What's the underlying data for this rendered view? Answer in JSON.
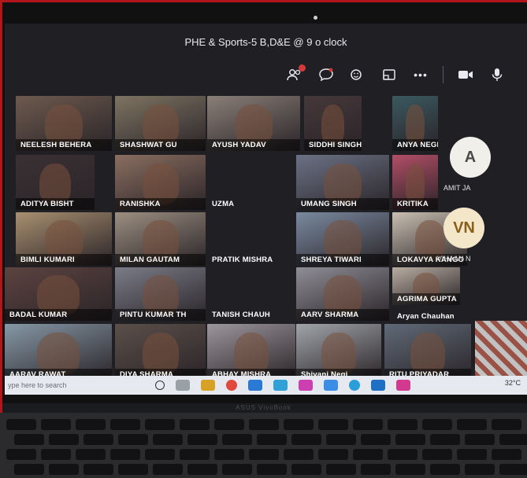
{
  "meeting": {
    "title": "PHE & Sports-5 B,D&E @ 9 o clock"
  },
  "toolbar": {
    "items": [
      {
        "icon": "participants-icon",
        "badge": "2"
      },
      {
        "icon": "chat-icon"
      },
      {
        "icon": "reactions-icon"
      },
      {
        "icon": "share-screen-icon"
      },
      {
        "icon": "more-icon",
        "glyph": "•••"
      },
      {
        "icon": "camera-icon"
      },
      {
        "icon": "microphone-icon"
      }
    ]
  },
  "participants": [
    {
      "name": "NEELESH BEHERA"
    },
    {
      "name": "SHASHWAT GU"
    },
    {
      "name": "AYUSH YADAV"
    },
    {
      "name": "SIDDHI SINGH"
    },
    {
      "name": "ANYA NEGI"
    },
    {
      "name": "ADITYA BISHT"
    },
    {
      "name": "RANISHKA"
    },
    {
      "name": "UZMA"
    },
    {
      "name": "UMANG SINGH"
    },
    {
      "name": "KRITIKA"
    },
    {
      "name": "BIMLI KUMARI"
    },
    {
      "name": "MILAN GAUTAM"
    },
    {
      "name": "PRATIK MISHRA"
    },
    {
      "name": "SHREYA TIWARI"
    },
    {
      "name": "LOKAVYA KANGO"
    },
    {
      "name": "BADAL KUMAR"
    },
    {
      "name": "PINTU KUMAR TH"
    },
    {
      "name": "TANISH CHAUH"
    },
    {
      "name": "AARV SHARMA"
    },
    {
      "name": "AGRIMA GUPTA"
    },
    {
      "name": "Aryan Chauhan"
    },
    {
      "name": "AARAV RAWAT"
    },
    {
      "name": "DIYA SHARMA"
    },
    {
      "name": "ABHAY MISHRA"
    },
    {
      "name": "Shivani Negi"
    },
    {
      "name": "RITU PRIYADAR"
    }
  ],
  "side_panel": [
    {
      "initials": "A",
      "name": "AMIT JA",
      "bg": "#f1efe9",
      "fg": "#4a4a4a"
    },
    {
      "initials": "VN",
      "name": "VIHAAN N",
      "bg": "#f4e7c9",
      "fg": "#8b5e1a"
    }
  ],
  "taskbar": {
    "search_placeholder": "ype here to search",
    "tray": "32°C"
  },
  "laptop": {
    "brand": "ASUS VivoBook"
  },
  "colors": {
    "screen_bg": "#201f24",
    "frame": "#b3161a",
    "badge": "#d33b3b"
  }
}
